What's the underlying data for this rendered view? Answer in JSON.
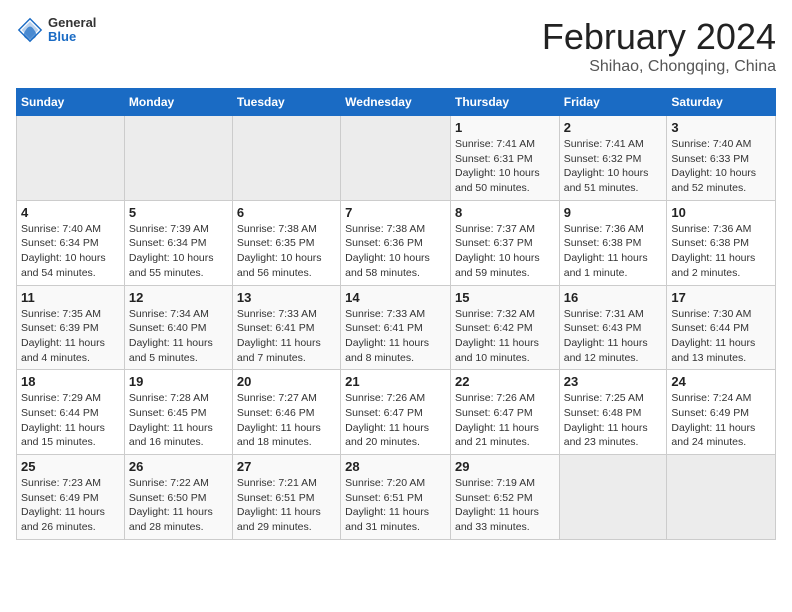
{
  "header": {
    "logo_general": "General",
    "logo_blue": "Blue",
    "title": "February 2024",
    "subtitle": "Shihao, Chongqing, China"
  },
  "weekdays": [
    "Sunday",
    "Monday",
    "Tuesday",
    "Wednesday",
    "Thursday",
    "Friday",
    "Saturday"
  ],
  "weeks": [
    [
      {
        "day": "",
        "sunrise": "",
        "sunset": "",
        "daylight": ""
      },
      {
        "day": "",
        "sunrise": "",
        "sunset": "",
        "daylight": ""
      },
      {
        "day": "",
        "sunrise": "",
        "sunset": "",
        "daylight": ""
      },
      {
        "day": "",
        "sunrise": "",
        "sunset": "",
        "daylight": ""
      },
      {
        "day": "1",
        "sunrise": "Sunrise: 7:41 AM",
        "sunset": "Sunset: 6:31 PM",
        "daylight": "Daylight: 10 hours and 50 minutes."
      },
      {
        "day": "2",
        "sunrise": "Sunrise: 7:41 AM",
        "sunset": "Sunset: 6:32 PM",
        "daylight": "Daylight: 10 hours and 51 minutes."
      },
      {
        "day": "3",
        "sunrise": "Sunrise: 7:40 AM",
        "sunset": "Sunset: 6:33 PM",
        "daylight": "Daylight: 10 hours and 52 minutes."
      }
    ],
    [
      {
        "day": "4",
        "sunrise": "Sunrise: 7:40 AM",
        "sunset": "Sunset: 6:34 PM",
        "daylight": "Daylight: 10 hours and 54 minutes."
      },
      {
        "day": "5",
        "sunrise": "Sunrise: 7:39 AM",
        "sunset": "Sunset: 6:34 PM",
        "daylight": "Daylight: 10 hours and 55 minutes."
      },
      {
        "day": "6",
        "sunrise": "Sunrise: 7:38 AM",
        "sunset": "Sunset: 6:35 PM",
        "daylight": "Daylight: 10 hours and 56 minutes."
      },
      {
        "day": "7",
        "sunrise": "Sunrise: 7:38 AM",
        "sunset": "Sunset: 6:36 PM",
        "daylight": "Daylight: 10 hours and 58 minutes."
      },
      {
        "day": "8",
        "sunrise": "Sunrise: 7:37 AM",
        "sunset": "Sunset: 6:37 PM",
        "daylight": "Daylight: 10 hours and 59 minutes."
      },
      {
        "day": "9",
        "sunrise": "Sunrise: 7:36 AM",
        "sunset": "Sunset: 6:38 PM",
        "daylight": "Daylight: 11 hours and 1 minute."
      },
      {
        "day": "10",
        "sunrise": "Sunrise: 7:36 AM",
        "sunset": "Sunset: 6:38 PM",
        "daylight": "Daylight: 11 hours and 2 minutes."
      }
    ],
    [
      {
        "day": "11",
        "sunrise": "Sunrise: 7:35 AM",
        "sunset": "Sunset: 6:39 PM",
        "daylight": "Daylight: 11 hours and 4 minutes."
      },
      {
        "day": "12",
        "sunrise": "Sunrise: 7:34 AM",
        "sunset": "Sunset: 6:40 PM",
        "daylight": "Daylight: 11 hours and 5 minutes."
      },
      {
        "day": "13",
        "sunrise": "Sunrise: 7:33 AM",
        "sunset": "Sunset: 6:41 PM",
        "daylight": "Daylight: 11 hours and 7 minutes."
      },
      {
        "day": "14",
        "sunrise": "Sunrise: 7:33 AM",
        "sunset": "Sunset: 6:41 PM",
        "daylight": "Daylight: 11 hours and 8 minutes."
      },
      {
        "day": "15",
        "sunrise": "Sunrise: 7:32 AM",
        "sunset": "Sunset: 6:42 PM",
        "daylight": "Daylight: 11 hours and 10 minutes."
      },
      {
        "day": "16",
        "sunrise": "Sunrise: 7:31 AM",
        "sunset": "Sunset: 6:43 PM",
        "daylight": "Daylight: 11 hours and 12 minutes."
      },
      {
        "day": "17",
        "sunrise": "Sunrise: 7:30 AM",
        "sunset": "Sunset: 6:44 PM",
        "daylight": "Daylight: 11 hours and 13 minutes."
      }
    ],
    [
      {
        "day": "18",
        "sunrise": "Sunrise: 7:29 AM",
        "sunset": "Sunset: 6:44 PM",
        "daylight": "Daylight: 11 hours and 15 minutes."
      },
      {
        "day": "19",
        "sunrise": "Sunrise: 7:28 AM",
        "sunset": "Sunset: 6:45 PM",
        "daylight": "Daylight: 11 hours and 16 minutes."
      },
      {
        "day": "20",
        "sunrise": "Sunrise: 7:27 AM",
        "sunset": "Sunset: 6:46 PM",
        "daylight": "Daylight: 11 hours and 18 minutes."
      },
      {
        "day": "21",
        "sunrise": "Sunrise: 7:26 AM",
        "sunset": "Sunset: 6:47 PM",
        "daylight": "Daylight: 11 hours and 20 minutes."
      },
      {
        "day": "22",
        "sunrise": "Sunrise: 7:26 AM",
        "sunset": "Sunset: 6:47 PM",
        "daylight": "Daylight: 11 hours and 21 minutes."
      },
      {
        "day": "23",
        "sunrise": "Sunrise: 7:25 AM",
        "sunset": "Sunset: 6:48 PM",
        "daylight": "Daylight: 11 hours and 23 minutes."
      },
      {
        "day": "24",
        "sunrise": "Sunrise: 7:24 AM",
        "sunset": "Sunset: 6:49 PM",
        "daylight": "Daylight: 11 hours and 24 minutes."
      }
    ],
    [
      {
        "day": "25",
        "sunrise": "Sunrise: 7:23 AM",
        "sunset": "Sunset: 6:49 PM",
        "daylight": "Daylight: 11 hours and 26 minutes."
      },
      {
        "day": "26",
        "sunrise": "Sunrise: 7:22 AM",
        "sunset": "Sunset: 6:50 PM",
        "daylight": "Daylight: 11 hours and 28 minutes."
      },
      {
        "day": "27",
        "sunrise": "Sunrise: 7:21 AM",
        "sunset": "Sunset: 6:51 PM",
        "daylight": "Daylight: 11 hours and 29 minutes."
      },
      {
        "day": "28",
        "sunrise": "Sunrise: 7:20 AM",
        "sunset": "Sunset: 6:51 PM",
        "daylight": "Daylight: 11 hours and 31 minutes."
      },
      {
        "day": "29",
        "sunrise": "Sunrise: 7:19 AM",
        "sunset": "Sunset: 6:52 PM",
        "daylight": "Daylight: 11 hours and 33 minutes."
      },
      {
        "day": "",
        "sunrise": "",
        "sunset": "",
        "daylight": ""
      },
      {
        "day": "",
        "sunrise": "",
        "sunset": "",
        "daylight": ""
      }
    ]
  ]
}
